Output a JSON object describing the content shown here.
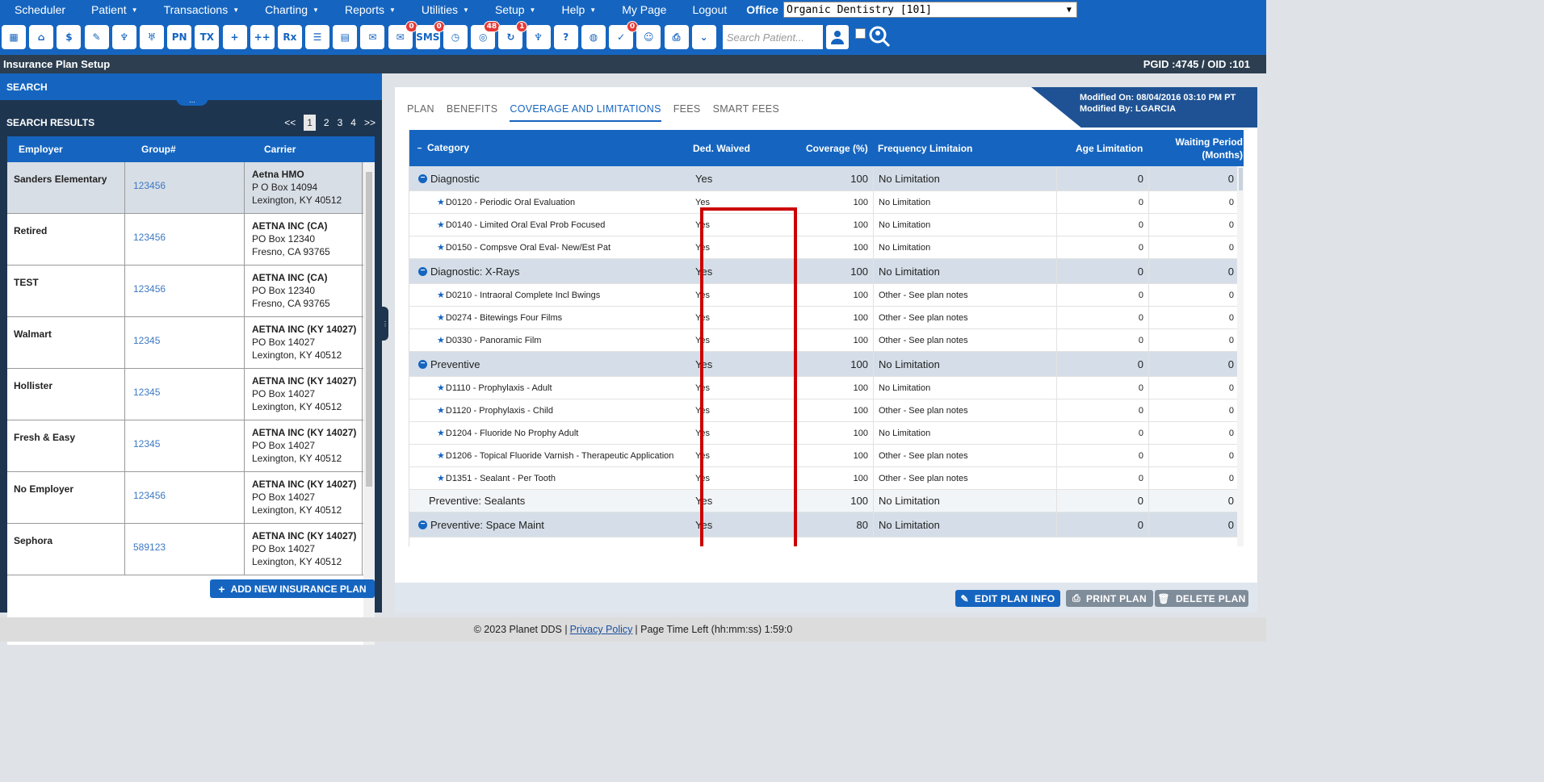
{
  "menu": {
    "items": [
      "Scheduler",
      "Patient",
      "Transactions",
      "Charting",
      "Reports",
      "Utilities",
      "Setup",
      "Help",
      "My Page",
      "Logout"
    ],
    "office_label": "Office",
    "office_value": "Organic Dentistry [101]"
  },
  "toolbar": {
    "icons": [
      {
        "name": "calendar-icon",
        "glyph": "▦"
      },
      {
        "name": "home-icon",
        "glyph": "⌂"
      },
      {
        "name": "dollar-icon",
        "glyph": "$"
      },
      {
        "name": "edit-note-icon",
        "glyph": "✎"
      },
      {
        "name": "tooth-icon",
        "glyph": "♆"
      },
      {
        "name": "tooth-chart-icon",
        "glyph": "♅"
      },
      {
        "name": "pn-icon",
        "glyph": "PN"
      },
      {
        "name": "tx-icon",
        "glyph": "TX"
      },
      {
        "name": "add-person-icon",
        "glyph": "+"
      },
      {
        "name": "add-family-icon",
        "glyph": "++"
      },
      {
        "name": "rx-icon",
        "glyph": "Rx"
      },
      {
        "name": "notes-icon",
        "glyph": "☰"
      },
      {
        "name": "document-icon",
        "glyph": "▤"
      },
      {
        "name": "envelope-icon",
        "glyph": "✉"
      },
      {
        "name": "message-icon",
        "glyph": "✉",
        "badge": "0"
      },
      {
        "name": "sms-icon",
        "glyph": "SMS",
        "badge": "0"
      },
      {
        "name": "clock-icon",
        "glyph": "◷"
      },
      {
        "name": "globe-people-icon",
        "glyph": "◎",
        "badge": "48"
      },
      {
        "name": "refresh-person-icon",
        "glyph": "↻",
        "badge": "1"
      },
      {
        "name": "tooth-outline-icon",
        "glyph": "♆"
      },
      {
        "name": "tooth-question-icon",
        "glyph": "?"
      },
      {
        "name": "globe-icon",
        "glyph": "◍"
      },
      {
        "name": "checklist-icon",
        "glyph": "✓",
        "badge": "0"
      },
      {
        "name": "group-icon",
        "glyph": "☺"
      },
      {
        "name": "printer-icon",
        "glyph": "⎙"
      },
      {
        "name": "chevron-down-box-icon",
        "glyph": "⌄"
      }
    ],
    "search_placeholder": "Search Patient..."
  },
  "title": {
    "page": "Insurance Plan Setup",
    "ids": "PGID :4745  /  OID :101"
  },
  "search_panel": {
    "header": "SEARCH",
    "results_title": "SEARCH RESULTS",
    "pager": [
      "<<",
      "1",
      "2",
      "3",
      "4",
      ">>"
    ],
    "columns": [
      "Employer",
      "Group#",
      "Carrier"
    ],
    "rows": [
      {
        "employer": "Sanders Elementary",
        "group": "123456",
        "carrier_name": "Aetna HMO",
        "carrier_addr": "P O Box 14094",
        "carrier_city": "Lexington, KY 40512"
      },
      {
        "employer": "Retired",
        "group": "123456",
        "carrier_name": "AETNA INC (CA)",
        "carrier_addr": "PO Box 12340",
        "carrier_city": "Fresno, CA 93765"
      },
      {
        "employer": "TEST",
        "group": "123456",
        "carrier_name": "AETNA INC (CA)",
        "carrier_addr": "PO Box 12340",
        "carrier_city": "Fresno, CA 93765"
      },
      {
        "employer": "Walmart",
        "group": "12345",
        "carrier_name": "AETNA INC (KY 14027)",
        "carrier_addr": "PO Box 14027",
        "carrier_city": "Lexington, KY 40512"
      },
      {
        "employer": "Hollister",
        "group": "12345",
        "carrier_name": "AETNA INC (KY 14027)",
        "carrier_addr": "PO Box 14027",
        "carrier_city": "Lexington, KY 40512"
      },
      {
        "employer": "Fresh & Easy",
        "group": "12345",
        "carrier_name": "AETNA INC (KY 14027)",
        "carrier_addr": "PO Box 14027",
        "carrier_city": "Lexington, KY 40512"
      },
      {
        "employer": "No Employer",
        "group": "123456",
        "carrier_name": "AETNA INC (KY 14027)",
        "carrier_addr": "PO Box 14027",
        "carrier_city": "Lexington, KY 40512"
      },
      {
        "employer": "Sephora",
        "group": "589123",
        "carrier_name": "AETNA INC (KY 14027)",
        "carrier_addr": "PO Box 14027",
        "carrier_city": "Lexington, KY 40512"
      }
    ],
    "add_button": "ADD NEW INSURANCE PLAN"
  },
  "plan_panel": {
    "modified_on": "Modified On: 08/04/2016 03:10 PM PT",
    "modified_by": "Modified By: LGARCIA",
    "tabs": [
      "PLAN",
      "BENEFITS",
      "COVERAGE AND LIMITATIONS",
      "FEES",
      "SMART FEES"
    ],
    "active_tab": "COVERAGE AND LIMITATIONS",
    "columns": {
      "category": "Category",
      "ded_waived": "Ded. Waived",
      "coverage": "Coverage (%)",
      "frequency": "Frequency Limitaion",
      "age": "Age Limitation",
      "waiting_1": "Waiting Period",
      "waiting_2": "(Months)"
    },
    "rows": [
      {
        "type": "cat",
        "label": "Diagnostic",
        "ded": "Yes",
        "cov": "100",
        "freq": "No Limitation",
        "age": "0",
        "wait": "0"
      },
      {
        "type": "proc",
        "label": "D0120 - Periodic Oral Evaluation",
        "ded": "Yes",
        "cov": "100",
        "freq": "No Limitation",
        "age": "0",
        "wait": "0"
      },
      {
        "type": "proc",
        "label": "D0140 - Limited Oral Eval Prob Focused",
        "ded": "Yes",
        "cov": "100",
        "freq": "No Limitation",
        "age": "0",
        "wait": "0"
      },
      {
        "type": "proc",
        "label": "D0150 - Compsve Oral Eval- New/Est Pat",
        "ded": "Yes",
        "cov": "100",
        "freq": "No Limitation",
        "age": "0",
        "wait": "0"
      },
      {
        "type": "cat",
        "label": "Diagnostic: X-Rays",
        "ded": "Yes",
        "cov": "100",
        "freq": "No Limitation",
        "age": "0",
        "wait": "0"
      },
      {
        "type": "proc",
        "label": "D0210 - Intraoral Complete Incl Bwings",
        "ded": "Yes",
        "cov": "100",
        "freq": "Other - See plan notes",
        "age": "0",
        "wait": "0"
      },
      {
        "type": "proc",
        "label": "D0274 - Bitewings Four Films",
        "ded": "Yes",
        "cov": "100",
        "freq": "Other - See plan notes",
        "age": "0",
        "wait": "0"
      },
      {
        "type": "proc",
        "label": "D0330 - Panoramic Film",
        "ded": "Yes",
        "cov": "100",
        "freq": "Other - See plan notes",
        "age": "0",
        "wait": "0"
      },
      {
        "type": "cat",
        "label": "Preventive",
        "ded": "Yes",
        "cov": "100",
        "freq": "No Limitation",
        "age": "0",
        "wait": "0"
      },
      {
        "type": "proc",
        "label": "D1110 - Prophylaxis - Adult",
        "ded": "Yes",
        "cov": "100",
        "freq": "No Limitation",
        "age": "0",
        "wait": "0"
      },
      {
        "type": "proc",
        "label": "D1120 - Prophylaxis - Child",
        "ded": "Yes",
        "cov": "100",
        "freq": "Other - See plan notes",
        "age": "0",
        "wait": "0"
      },
      {
        "type": "proc",
        "label": "D1204 - Fluoride No Prophy Adult",
        "ded": "Yes",
        "cov": "100",
        "freq": "No Limitation",
        "age": "0",
        "wait": "0"
      },
      {
        "type": "proc",
        "label": "D1206 - Topical Fluoride Varnish - Therapeutic Application",
        "ded": "Yes",
        "cov": "100",
        "freq": "Other - See plan notes",
        "age": "0",
        "wait": "0"
      },
      {
        "type": "proc",
        "label": "D1351 - Sealant - Per Tooth",
        "ded": "Yes",
        "cov": "100",
        "freq": "Other - See plan notes",
        "age": "0",
        "wait": "0"
      },
      {
        "type": "plain",
        "label": "Preventive: Sealants",
        "ded": "Yes",
        "cov": "100",
        "freq": "No Limitation",
        "age": "0",
        "wait": "0"
      },
      {
        "type": "cat",
        "label": "Preventive: Space Maint",
        "ded": "Yes",
        "cov": "80",
        "freq": "No Limitation",
        "age": "0",
        "wait": "0"
      }
    ],
    "buttons": {
      "edit": "EDIT PLAN INFO",
      "print": "PRINT PLAN",
      "delete": "DELETE PLAN"
    }
  },
  "footer": {
    "copyright": "© 2023 Planet DDS |",
    "privacy": "Privacy Policy",
    "time_left": "|  Page Time Left (hh:mm:ss) 1:59:0"
  },
  "colors": {
    "brand": "#1565c0",
    "dark": "#1e3550",
    "highlight": "#cc0000"
  }
}
